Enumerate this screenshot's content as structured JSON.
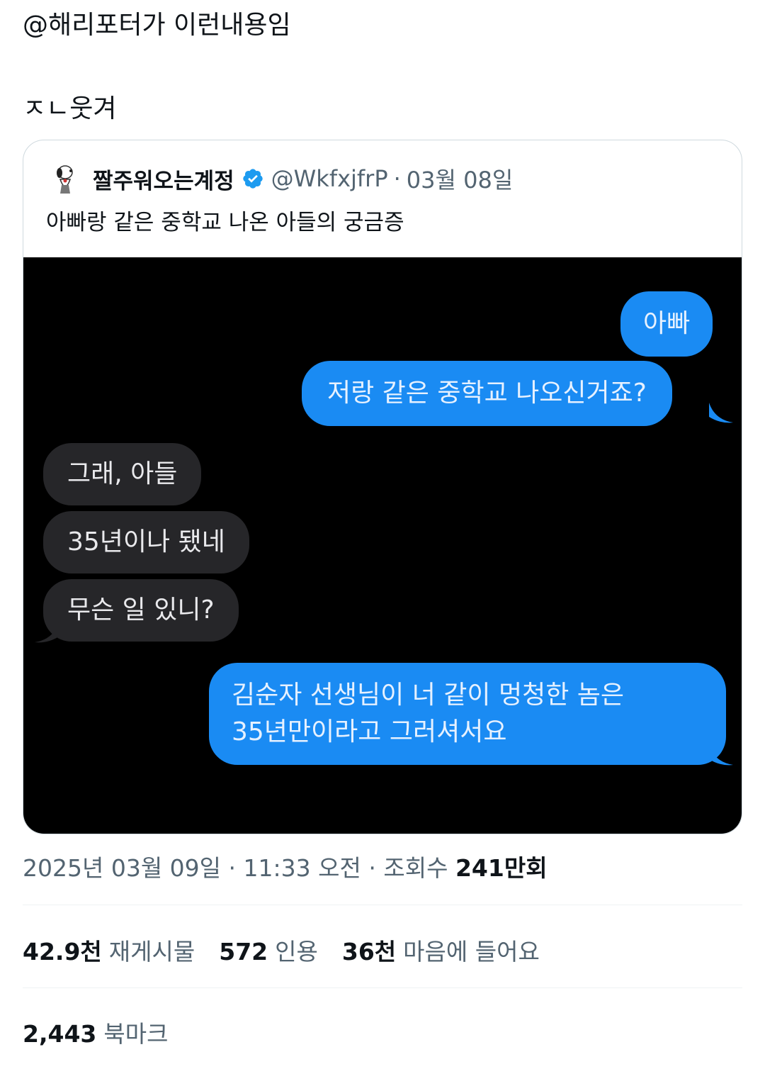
{
  "post": {
    "lines": [
      "@해리포터가 이런내용임",
      "ㅈㄴ웃겨"
    ]
  },
  "quote": {
    "avatar_icon": "snoopy-avatar",
    "name": "짤주워오는계정",
    "verified_icon": "verified-badge-icon",
    "handle": "@WkfxjfrP",
    "separator": "·",
    "date": "03월 08일",
    "text": "아빠랑 같은 중학교 나온 아들의 궁금증"
  },
  "chat": {
    "messages": [
      {
        "from": "me",
        "text": "아빠"
      },
      {
        "from": "me",
        "text": "저랑 같은 중학교 나오신거죠?"
      },
      {
        "from": "them",
        "text": "그래, 아들"
      },
      {
        "from": "them",
        "text": "35년이나 됐네"
      },
      {
        "from": "them",
        "text": "무슨 일 있니?"
      },
      {
        "from": "me",
        "text": "김순자 선생님이 너 같이 멍청한 놈은"
      },
      {
        "from": "me",
        "text": "35년만이라고 그러셔서요"
      }
    ],
    "colors": {
      "me": "#1a8bf3",
      "them": "#262629",
      "background": "#000000"
    }
  },
  "meta": {
    "date": "2025년 03월 09일",
    "separator": "·",
    "time": "11:33 오전",
    "views_label": "조회수",
    "views_number": "241",
    "views_unit": "만회"
  },
  "stats": {
    "reposts": {
      "value": "42.9천",
      "label": "재게시물"
    },
    "quotes": {
      "value": "572",
      "label": "인용"
    },
    "likes": {
      "value": "36천",
      "label": "마음에 들어요"
    },
    "bookmarks": {
      "value": "2,443",
      "label": "북마크"
    }
  }
}
